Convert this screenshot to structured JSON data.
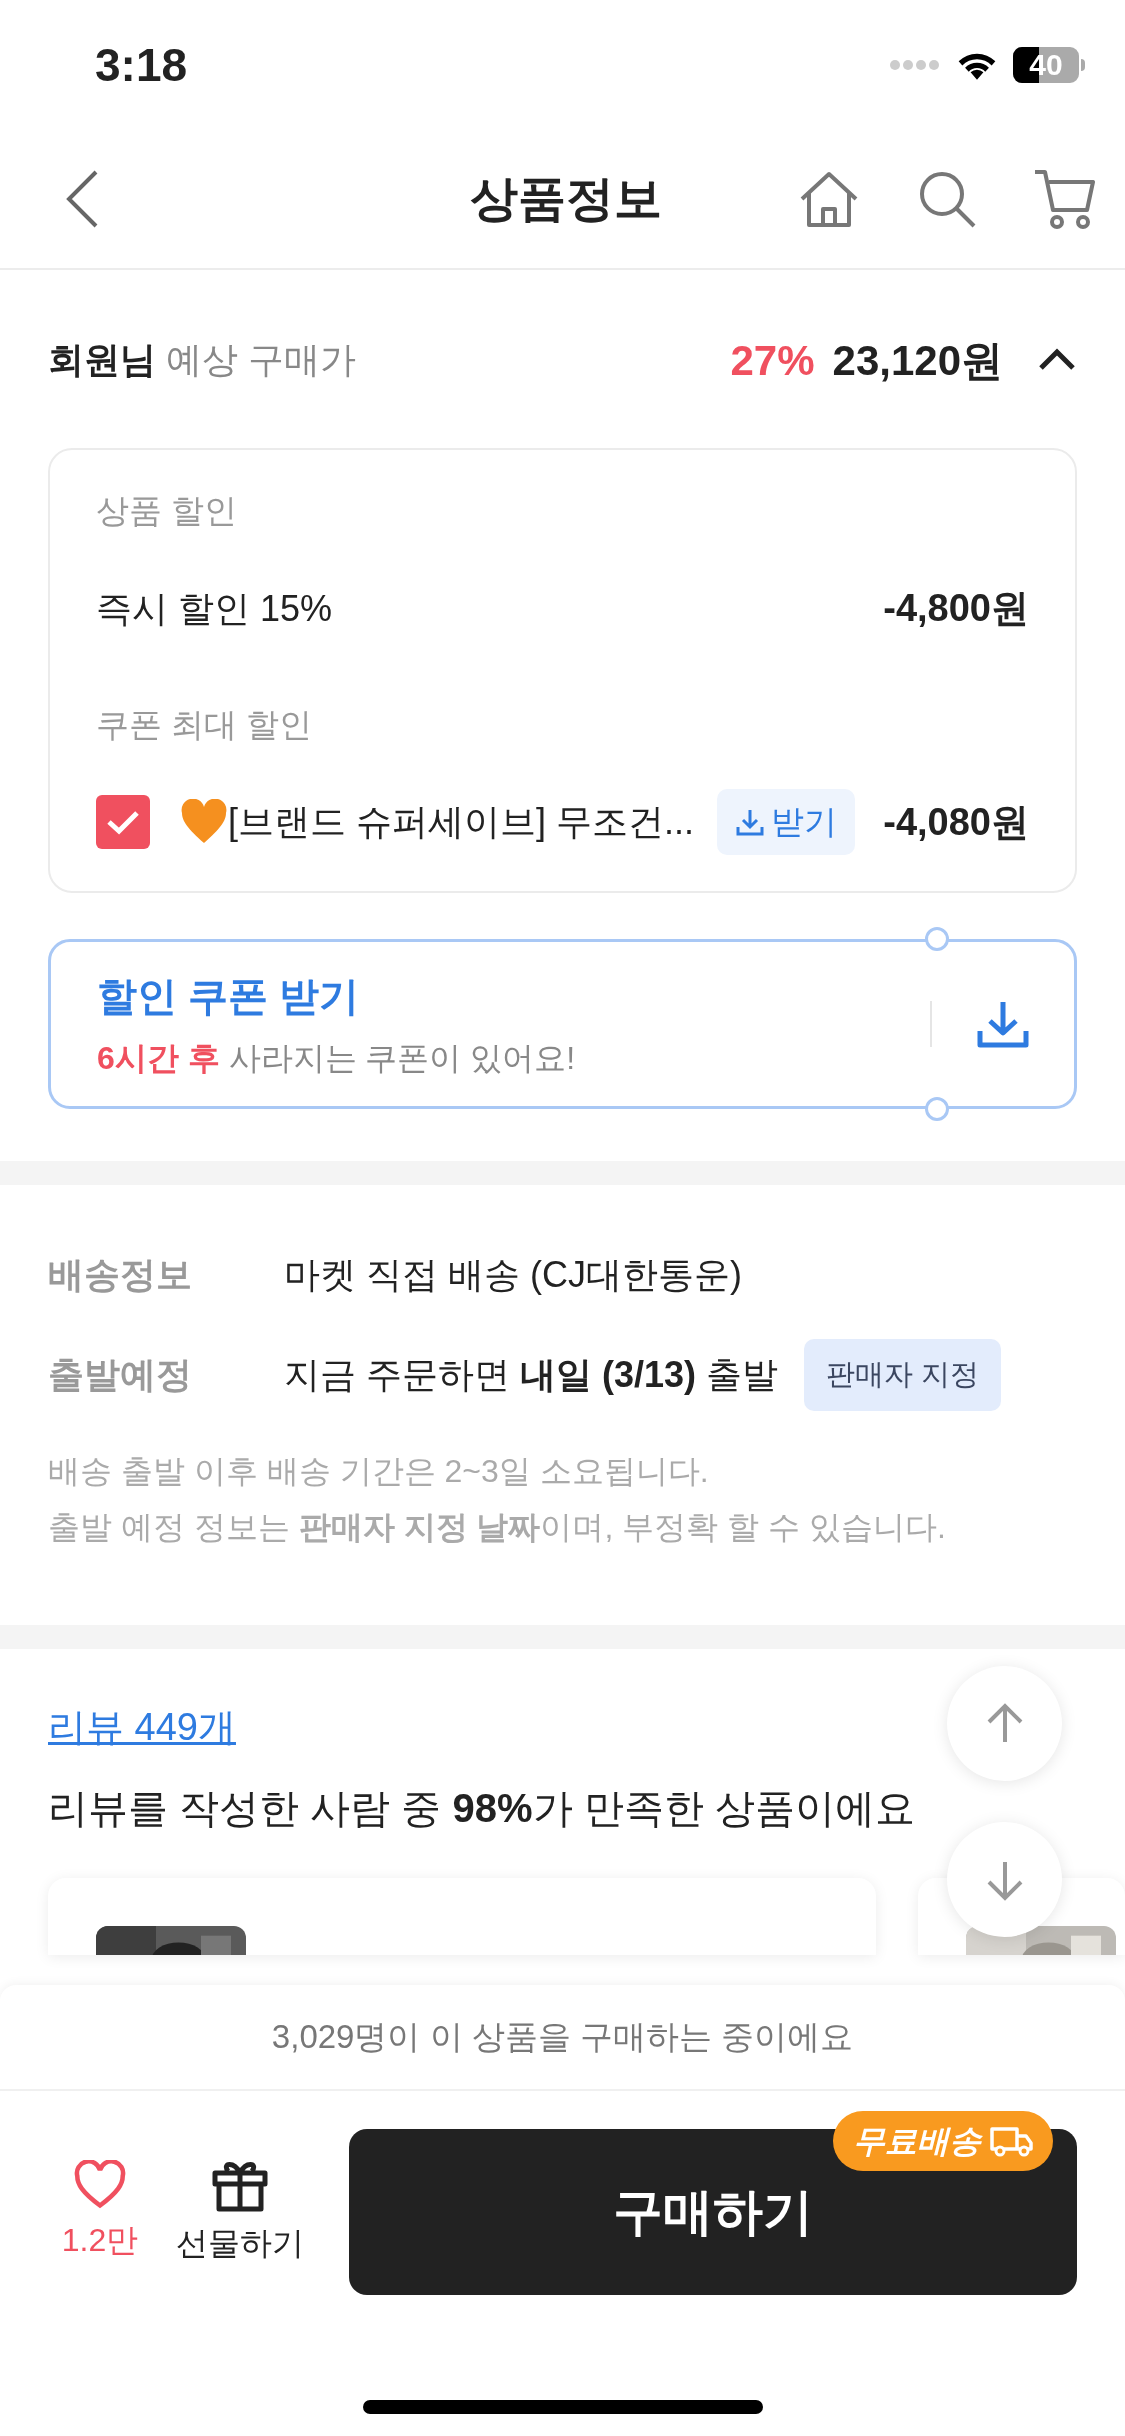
{
  "status_bar": {
    "time": "3:18",
    "battery": "40"
  },
  "nav": {
    "title": "상품정보"
  },
  "price_summary": {
    "member": "회원님",
    "label": "예상 구매가",
    "discount": "27%",
    "price": "23,120원",
    "expanded": true
  },
  "discount_card": {
    "sections": [
      {
        "title": "상품 할인",
        "items": [
          {
            "kind": "plain",
            "label": "즉시 할인 15%",
            "amount": "-4,800원"
          }
        ]
      },
      {
        "title": "쿠폰 최대 할인",
        "items": [
          {
            "kind": "coupon",
            "checked": true,
            "label": "[브랜드 슈퍼세이브] 무조건...",
            "action": "받기",
            "amount": "-4,080원"
          }
        ]
      }
    ]
  },
  "coupon_banner": {
    "title": "할인 쿠폰 받기",
    "highlight": "6시간 후",
    "text": "사라지는 쿠폰이 있어요!"
  },
  "shipping": {
    "rows": [
      {
        "label": "배송정보",
        "value": "마켓 직접 배송 (CJ대한통운)"
      },
      {
        "label": "출발예정",
        "value": "지금 주문하면 **내일 (3/13)** 출발",
        "badge": "판매자 지정"
      }
    ],
    "notes": [
      "배송 출발 이후 배송 기간은 2~3일 소요됩니다.",
      "출발 예정 정보는 **판매자 지정 날짜**이며, 부정확 할 수 있습니다."
    ]
  },
  "reviews": {
    "link": "리뷰 449개",
    "summary": "리뷰를 작성한 사람 중 **98%**가 만족한 상품이에요"
  },
  "bottom_bar": {
    "notice": "3,029명이 이 상품을 구매하는 중이에요",
    "like_count": "1.2만",
    "gift": "선물하기",
    "buy": "구매하기",
    "shipping_badge": "무료배송"
  }
}
